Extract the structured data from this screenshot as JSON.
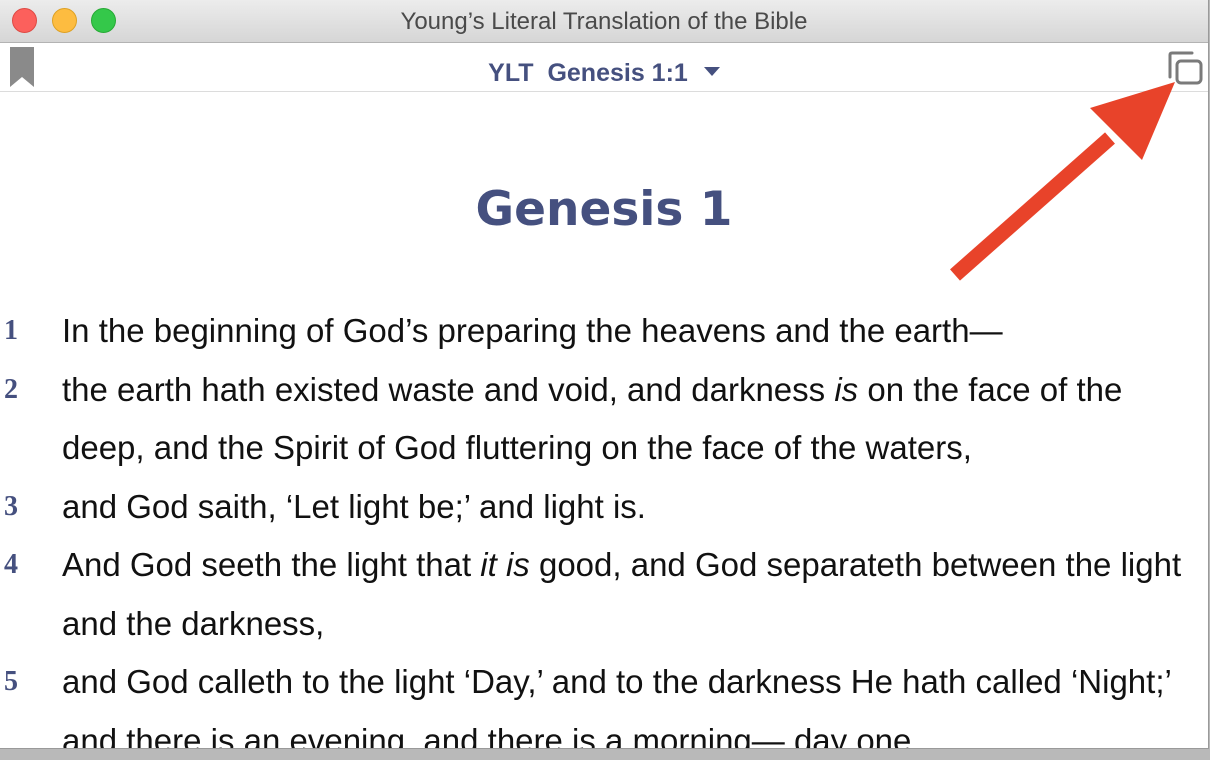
{
  "window": {
    "title": "Young’s Literal Translation of the Bible"
  },
  "toolbar": {
    "version": "YLT",
    "reference": "Genesis 1:1"
  },
  "chapter": {
    "heading": "Genesis 1",
    "verses": [
      {
        "num": "1",
        "segments": [
          {
            "text": "In the beginning of God’s preparing the heavens and the earth—",
            "italic": false
          }
        ]
      },
      {
        "num": "2",
        "segments": [
          {
            "text": "the earth hath existed waste and void, and darkness ",
            "italic": false
          },
          {
            "text": "is",
            "italic": true
          },
          {
            "text": " on the face of the deep, and the Spirit of God fluttering on the face of the waters,",
            "italic": false
          }
        ]
      },
      {
        "num": "3",
        "segments": [
          {
            "text": "and God saith, ‘Let light be;’ and light is.",
            "italic": false
          }
        ]
      },
      {
        "num": "4",
        "segments": [
          {
            "text": "And God seeth the light that ",
            "italic": false
          },
          {
            "text": "it is",
            "italic": true
          },
          {
            "text": " good, and God separateth between the light and the darkness,",
            "italic": false
          }
        ]
      },
      {
        "num": "5",
        "segments": [
          {
            "text": "and God calleth to the light ‘Day,’ and to the darkness He hath called ‘Night;’ and there is an evening, and there is a morning— day one.",
            "italic": false
          }
        ]
      }
    ]
  },
  "colors": {
    "accent": "#45507f",
    "annotation_arrow": "#e8432a"
  },
  "icons": {
    "bookmark": "bookmark-icon",
    "windows": "duplicate-window-icon",
    "dropdown": "caret-down-icon"
  }
}
